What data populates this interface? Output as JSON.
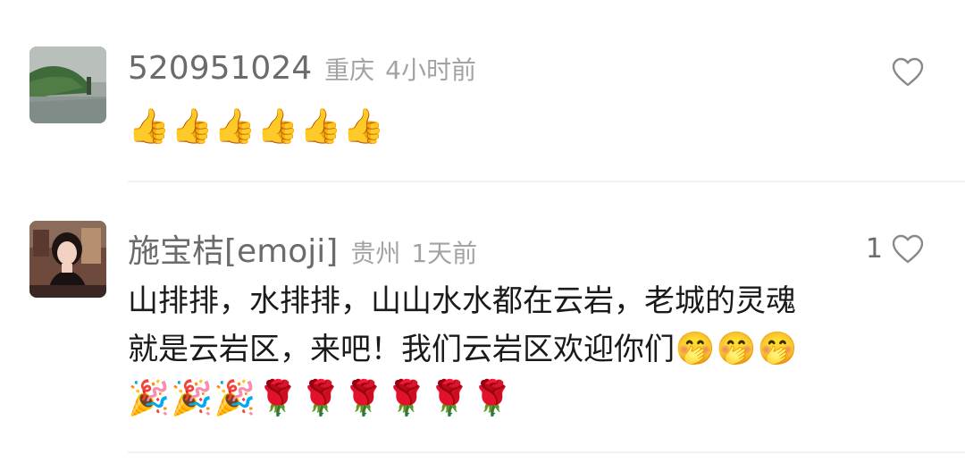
{
  "comments": [
    {
      "username": "520951024",
      "location": "重庆",
      "time": "4小时前",
      "like_count": "",
      "text_lines": [],
      "trailing_emojis": [],
      "emoji_row": [
        "👍",
        "👍",
        "👍",
        "👍",
        "👍",
        "👍"
      ],
      "avatar_icon": "landscape-lake-avatar",
      "like_icon": "heart-outline-icon"
    },
    {
      "username": "施宝桔[emoji]",
      "location": "贵州",
      "time": "1天前",
      "like_count": "1",
      "text_lines": [
        "山排排，水排排，山山水水都在云岩，老城的灵魂",
        "就是云岩区，来吧！我们云岩区欢迎你们"
      ],
      "trailing_emojis": [
        "🤭",
        "🤭",
        "🤭"
      ],
      "emoji_row": [
        "🎉",
        "🎉",
        "🎉",
        "🌹",
        "🌹",
        "🌹",
        "🌹",
        "🌹",
        "🌹"
      ],
      "avatar_icon": "woman-portrait-avatar",
      "like_icon": "heart-outline-icon"
    }
  ],
  "colors": {
    "username": "#6b6b6b",
    "meta": "#a3a3a3",
    "text": "#1a1a1a",
    "divider": "#f1f1f1",
    "heart": "#8a8a8a"
  }
}
